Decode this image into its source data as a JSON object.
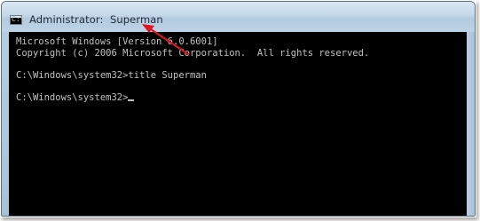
{
  "window": {
    "title": "Administrator:  Superman",
    "icon": "cmd-prompt-icon"
  },
  "console": {
    "lines": [
      "Microsoft Windows [Version 6.0.6001]",
      "Copyright (c) 2006 Microsoft Corporation.  All rights reserved.",
      "",
      "C:\\Windows\\system32>title Superman",
      "",
      "C:\\Windows\\system32>"
    ]
  },
  "annotation": {
    "arrow_color": "#e0141e",
    "arrow_icon": "red-arrow-icon"
  }
}
